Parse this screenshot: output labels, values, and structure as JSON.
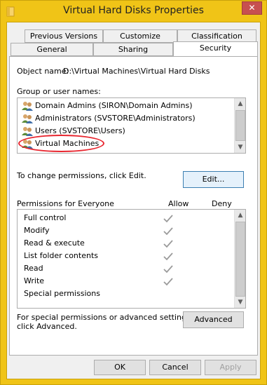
{
  "window": {
    "title": "Virtual Hard Disks Properties",
    "close_label": "✕"
  },
  "tabs": [
    {
      "label": "Previous Versions"
    },
    {
      "label": "Customize"
    },
    {
      "label": "Classification"
    },
    {
      "label": "General"
    },
    {
      "label": "Sharing"
    },
    {
      "label": "Security"
    }
  ],
  "security": {
    "object_name_label": "Object name:",
    "object_name_value": "D:\\Virtual Machines\\Virtual Hard Disks",
    "group_label": "Group or user names:",
    "groups": [
      {
        "name": "Domain Admins (SIRON\\Domain Admins)"
      },
      {
        "name": "Administrators (SVSTORE\\Administrators)"
      },
      {
        "name": "Users (SVSTORE\\Users)"
      },
      {
        "name": "Virtual Machines"
      }
    ],
    "change_text": "To change permissions, click Edit.",
    "edit_label": "Edit...",
    "permissions_for": "Permissions for Everyone",
    "allow_header": "Allow",
    "deny_header": "Deny",
    "permissions": [
      {
        "name": "Full control",
        "allow": true
      },
      {
        "name": "Modify",
        "allow": true
      },
      {
        "name": "Read & execute",
        "allow": true
      },
      {
        "name": "List folder contents",
        "allow": true
      },
      {
        "name": "Read",
        "allow": true
      },
      {
        "name": "Write",
        "allow": true
      },
      {
        "name": "Special permissions",
        "allow": false
      }
    ],
    "advanced_text_1": "For special permissions or advanced settings,",
    "advanced_text_2": "click Advanced.",
    "advanced_label": "Advanced"
  },
  "footer": {
    "ok_label": "OK",
    "cancel_label": "Cancel",
    "apply_label": "Apply"
  },
  "colors": {
    "frame": "#f0c417",
    "highlight": "#e8262f"
  }
}
